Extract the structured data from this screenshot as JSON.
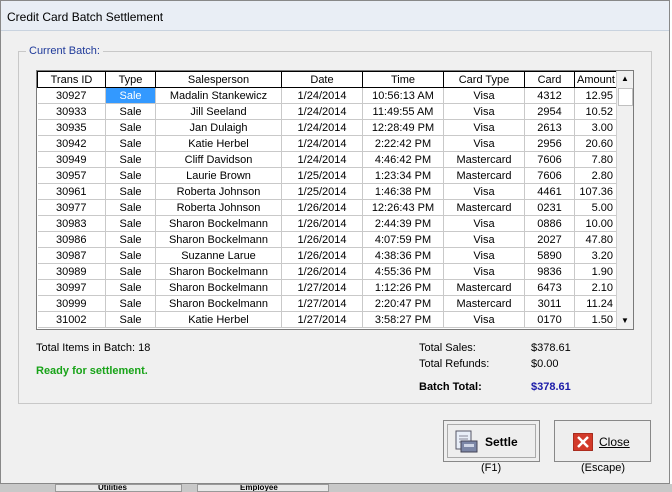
{
  "window": {
    "title": "Credit Card Batch Settlement"
  },
  "group_label": "Current Batch:",
  "table": {
    "columns": [
      "Trans ID",
      "Type",
      "Salesperson",
      "Date",
      "Time",
      "Card Type",
      "Card",
      "Amount"
    ],
    "rows": [
      [
        "30927",
        "Sale",
        "Madalin Stankewicz",
        "1/24/2014",
        "10:56:13 AM",
        "Visa",
        "4312",
        "12.95"
      ],
      [
        "30933",
        "Sale",
        "Jill Seeland",
        "1/24/2014",
        "11:49:55 AM",
        "Visa",
        "2954",
        "10.52"
      ],
      [
        "30935",
        "Sale",
        "Jan Dulaigh",
        "1/24/2014",
        "12:28:49 PM",
        "Visa",
        "2613",
        "3.00"
      ],
      [
        "30942",
        "Sale",
        "Katie Herbel",
        "1/24/2014",
        "2:22:42 PM",
        "Visa",
        "2956",
        "20.60"
      ],
      [
        "30949",
        "Sale",
        "Cliff Davidson",
        "1/24/2014",
        "4:46:42 PM",
        "Mastercard",
        "7606",
        "7.80"
      ],
      [
        "30957",
        "Sale",
        "Laurie Brown",
        "1/25/2014",
        "1:23:34 PM",
        "Mastercard",
        "7606",
        "2.80"
      ],
      [
        "30961",
        "Sale",
        "Roberta Johnson",
        "1/25/2014",
        "1:46:38 PM",
        "Visa",
        "4461",
        "107.36"
      ],
      [
        "30977",
        "Sale",
        "Roberta Johnson",
        "1/26/2014",
        "12:26:43 PM",
        "Mastercard",
        "0231",
        "5.00"
      ],
      [
        "30983",
        "Sale",
        "Sharon Bockelmann",
        "1/26/2014",
        "2:44:39 PM",
        "Visa",
        "0886",
        "10.00"
      ],
      [
        "30986",
        "Sale",
        "Sharon Bockelmann",
        "1/26/2014",
        "4:07:59 PM",
        "Visa",
        "2027",
        "47.80"
      ],
      [
        "30987",
        "Sale",
        "Suzanne Larue",
        "1/26/2014",
        "4:38:36 PM",
        "Visa",
        "5890",
        "3.20"
      ],
      [
        "30989",
        "Sale",
        "Sharon Bockelmann",
        "1/26/2014",
        "4:55:36 PM",
        "Visa",
        "9836",
        "1.90"
      ],
      [
        "30997",
        "Sale",
        "Sharon Bockelmann",
        "1/27/2014",
        "1:12:26 PM",
        "Mastercard",
        "6473",
        "2.10"
      ],
      [
        "30999",
        "Sale",
        "Sharon Bockelmann",
        "1/27/2014",
        "2:20:47 PM",
        "Mastercard",
        "3011",
        "11.24"
      ],
      [
        "31002",
        "Sale",
        "Katie Herbel",
        "1/27/2014",
        "3:58:27 PM",
        "Visa",
        "0170",
        "1.50"
      ]
    ],
    "selected_row": 0,
    "selected_col": 1
  },
  "summary": {
    "total_items_label": "Total Items in Batch: 18",
    "status": "Ready for settlement.",
    "total_sales_label": "Total Sales:",
    "total_sales_value": "$378.61",
    "total_refunds_label": "Total Refunds:",
    "total_refunds_value": "$0.00",
    "batch_total_label": "Batch Total:",
    "batch_total_value": "$378.61"
  },
  "buttons": {
    "settle_label": "Settle",
    "settle_key": "(F1)",
    "close_label": "Close",
    "close_key": "(Escape)"
  },
  "taskbar": {
    "item1": "Utilities",
    "item2": "Employee"
  },
  "colors": {
    "accent": "#3399ff",
    "status_green": "#18a318",
    "batch_total": "#1a1aa8",
    "group_label": "#1f3a9a"
  },
  "icons": {
    "scroll_up": "▲",
    "scroll_down": "▼",
    "settle": "printer-icon",
    "close": "close-x-icon"
  }
}
